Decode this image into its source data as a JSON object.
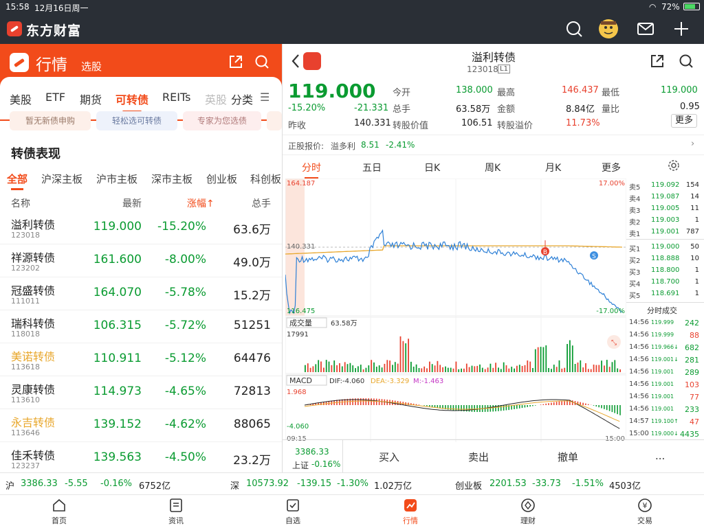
{
  "status": {
    "time": "15:58",
    "date": "12月16日周一",
    "battery": "72%"
  },
  "brand": {
    "name": "东方财富"
  },
  "left": {
    "title": "行情",
    "subtitle": "选股",
    "cat_tabs": [
      "美股",
      "ETF",
      "期货",
      "可转债",
      "REITs",
      "英股",
      "分类"
    ],
    "active_cat": 3,
    "promos": [
      "暂无新债申购",
      "轻松选可转债",
      "专家为您选债"
    ],
    "section_title": "转债表现",
    "market_tabs": [
      "全部",
      "沪深主板",
      "沪市主板",
      "深市主板",
      "创业板",
      "科创板"
    ],
    "columns": [
      "名称",
      "最新",
      "涨幅↑",
      "总手"
    ],
    "rows": [
      {
        "name": "溢利转债",
        "code": "123018",
        "price": "119.000",
        "pct": "-15.20%",
        "vol": "63.6万",
        "hl": false
      },
      {
        "name": "祥源转债",
        "code": "123202",
        "price": "161.600",
        "pct": "-8.00%",
        "vol": "49.0万",
        "hl": false
      },
      {
        "name": "冠盛转债",
        "code": "111011",
        "price": "164.070",
        "pct": "-5.78%",
        "vol": "15.2万",
        "hl": false
      },
      {
        "name": "瑞科转债",
        "code": "118018",
        "price": "106.315",
        "pct": "-5.72%",
        "vol": "51251",
        "hl": false
      },
      {
        "name": "美诺转债",
        "code": "113618",
        "price": "110.911",
        "pct": "-5.12%",
        "vol": "64476",
        "hl": true
      },
      {
        "name": "灵康转债",
        "code": "113610",
        "price": "114.973",
        "pct": "-4.65%",
        "vol": "72813",
        "hl": false
      },
      {
        "name": "永吉转债",
        "code": "113646",
        "price": "139.152",
        "pct": "-4.62%",
        "vol": "88065",
        "hl": true
      },
      {
        "name": "佳禾转债",
        "code": "123237",
        "price": "139.563",
        "pct": "-4.50%",
        "vol": "23.2万",
        "hl": false
      }
    ]
  },
  "right": {
    "name": "溢利转债",
    "code": "123018",
    "badge": "L1",
    "price": "119.000",
    "change_pct": "-15.20%",
    "change": "-21.331",
    "prev_label": "昨收",
    "prev": "140.331",
    "stats": [
      {
        "l": "今开",
        "v": "138.000",
        "c": "g"
      },
      {
        "l": "最高",
        "v": "146.437",
        "c": "r"
      },
      {
        "l": "最低",
        "v": "119.000",
        "c": "g"
      },
      {
        "l": "总手",
        "v": "63.58万",
        "c": ""
      },
      {
        "l": "金额",
        "v": "8.84亿",
        "c": ""
      },
      {
        "l": "量比",
        "v": "0.95",
        "c": ""
      },
      {
        "l": "转股价值",
        "v": "106.51",
        "c": ""
      },
      {
        "l": "转股溢价",
        "v": "11.73%",
        "c": "r"
      }
    ],
    "more": "更多",
    "stock_line": {
      "label": "正股报价:",
      "name": "溢多利",
      "price": "8.51",
      "pct": "-2.41%"
    },
    "time_tabs": [
      "分时",
      "五日",
      "日K",
      "周K",
      "月K",
      "更多"
    ],
    "chart": {
      "ymax": "164.187",
      "ymid": "140.331",
      "ymin": "116.475",
      "pmax": "17.00%",
      "pmin": "-17.00%",
      "vol_label": "成交量",
      "vol_total": "63.58万",
      "vol_max": "17991",
      "macd_label": "MACD",
      "dif": "DIF:-4.060",
      "dea": "DEA:-3.329",
      "m": "M:-1.463",
      "macd_max": "1.968",
      "macd_min": "-4.060",
      "t_start": "09:15",
      "t_end": "15:00",
      "buy_mark": "B",
      "sell_mark": "S"
    },
    "sell": [
      {
        "l": "卖5",
        "p": "119.092",
        "q": "154"
      },
      {
        "l": "卖4",
        "p": "119.087",
        "q": "14"
      },
      {
        "l": "卖3",
        "p": "119.005",
        "q": "11"
      },
      {
        "l": "卖2",
        "p": "119.003",
        "q": "1"
      },
      {
        "l": "卖1",
        "p": "119.001",
        "q": "787"
      }
    ],
    "buy": [
      {
        "l": "买1",
        "p": "119.000",
        "q": "50"
      },
      {
        "l": "买2",
        "p": "118.888",
        "q": "10"
      },
      {
        "l": "买3",
        "p": "118.800",
        "q": "1"
      },
      {
        "l": "买4",
        "p": "118.700",
        "q": "1"
      },
      {
        "l": "买5",
        "p": "118.691",
        "q": "1"
      }
    ],
    "trades_title": "分时成交",
    "trades": [
      {
        "t": "14:56",
        "p": "119.999",
        "q": "242",
        "c": "g"
      },
      {
        "t": "14:56",
        "p": "119.999",
        "q": "88",
        "c": "r"
      },
      {
        "t": "14:56",
        "p": "119.966↓",
        "q": "682",
        "c": "g"
      },
      {
        "t": "14:56",
        "p": "119.001↓",
        "q": "281",
        "c": "g"
      },
      {
        "t": "14:56",
        "p": "119.001",
        "q": "289",
        "c": "g"
      },
      {
        "t": "14:56",
        "p": "119.001",
        "q": "103",
        "c": "r"
      },
      {
        "t": "14:56",
        "p": "119.001",
        "q": "77",
        "c": "r"
      },
      {
        "t": "14:56",
        "p": "119.001",
        "q": "233",
        "c": "g"
      },
      {
        "t": "14:57",
        "p": "119.100↑",
        "q": "47",
        "c": "r"
      },
      {
        "t": "15:00",
        "p": "119.000↓",
        "q": "4435",
        "c": "g"
      }
    ],
    "index": {
      "value": "3386.33",
      "label": "上证",
      "pct": "-0.16%"
    },
    "actions": [
      "买入",
      "卖出",
      "撤单",
      "..."
    ]
  },
  "index_bar": [
    {
      "n": "沪",
      "v": "3386.33",
      "c": "-5.55",
      "p": "-0.16%",
      "a": "6752亿"
    },
    {
      "n": "深",
      "v": "10573.92",
      "c": "-139.15",
      "p": "-1.30%",
      "a": "1.02万亿"
    },
    {
      "n": "创业板",
      "v": "2201.53",
      "c": "-33.73",
      "p": "-1.51%",
      "a": "4503亿"
    }
  ],
  "nav": [
    "首页",
    "资讯",
    "自选",
    "行情",
    "理财",
    "交易"
  ],
  "nav_active": 3,
  "colors": {
    "accent": "#f24b1a",
    "green": "#0a9b31",
    "red": "#e8412e",
    "header": "#2a2f36"
  }
}
